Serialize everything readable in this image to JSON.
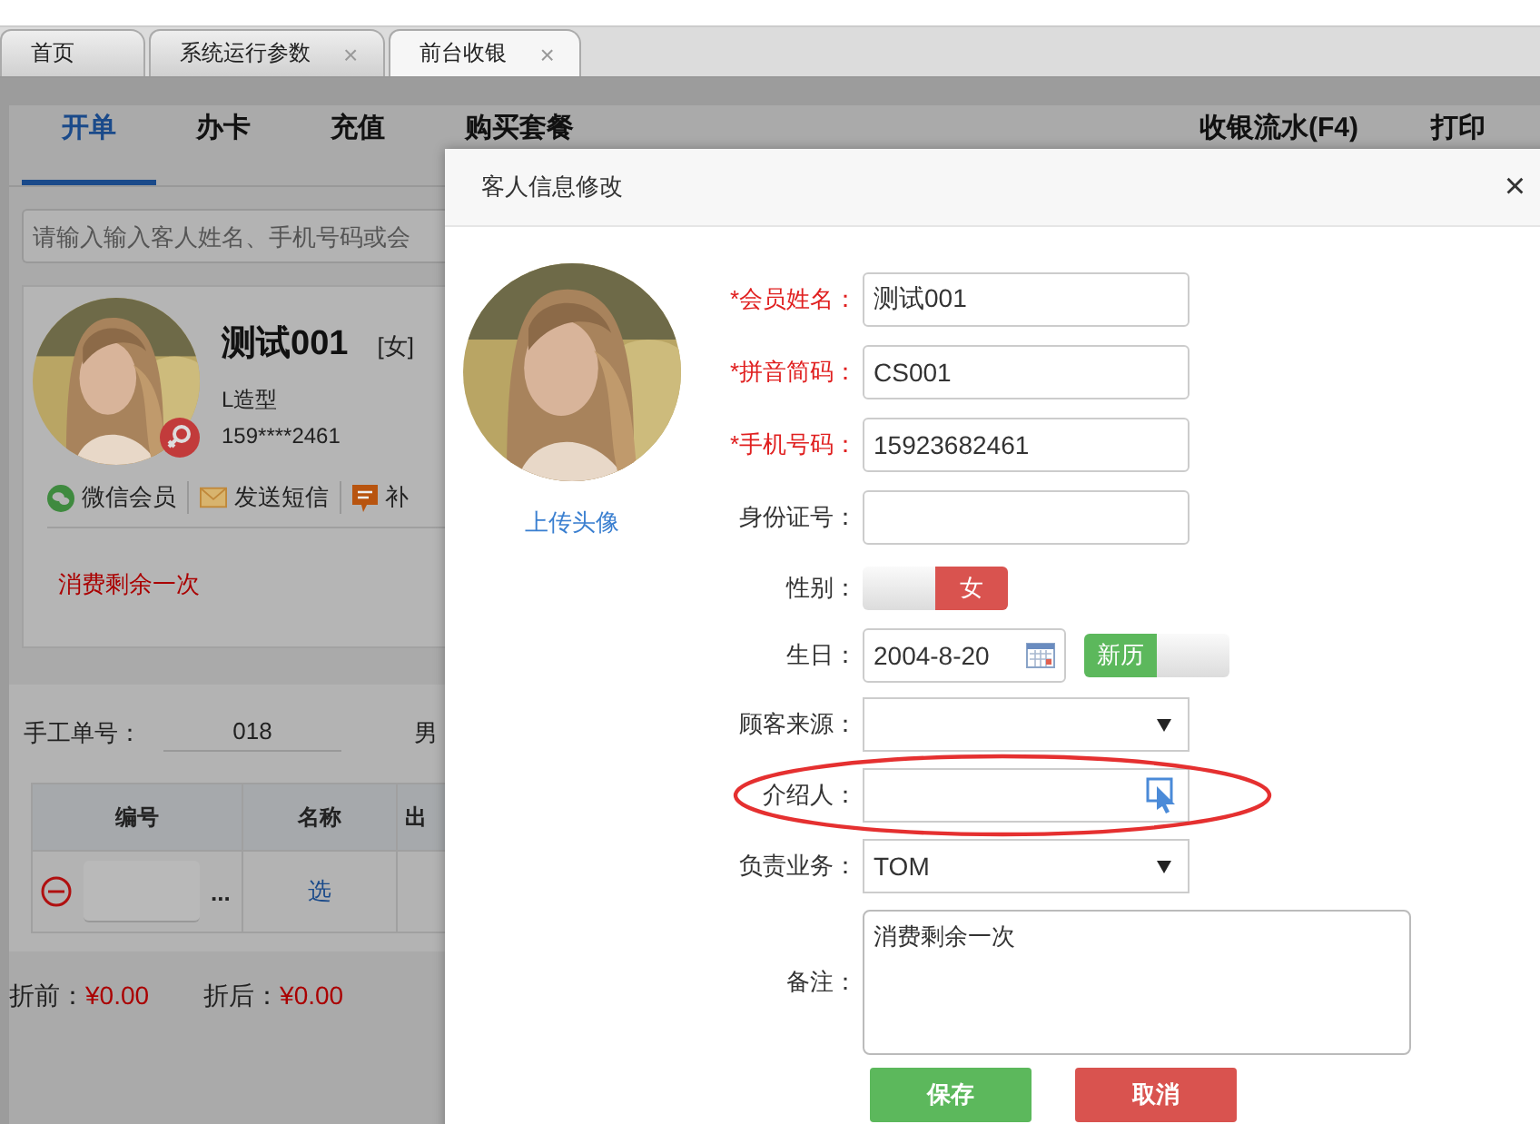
{
  "tabs": [
    {
      "label": "首页",
      "selected": false
    },
    {
      "label": "系统运行参数",
      "close": "×",
      "selected": false
    },
    {
      "label": "前台收银",
      "close": "×",
      "selected": true
    }
  ],
  "nav": {
    "tabs": [
      {
        "label": "开单",
        "selected": true
      },
      {
        "label": "办卡",
        "selected": false
      },
      {
        "label": "充值",
        "selected": false
      },
      {
        "label": "购买套餐",
        "selected": false
      }
    ],
    "actions": [
      "收银流水(F4)",
      "打印"
    ]
  },
  "search": {
    "placeholder": "请输入输入客人姓名、手机号码或会"
  },
  "customer": {
    "female": true,
    "name": "测试001",
    "gender": "[女]",
    "type": "L造型",
    "phone": "159****2461",
    "actions": [
      {
        "kind": "wechat",
        "label": "微信会员"
      },
      {
        "kind": "sms",
        "label": "发送短信"
      },
      {
        "kind": "message",
        "label": "补"
      }
    ],
    "note": "消费剩余一次"
  },
  "order": {
    "manual_no_label": "手工单号：",
    "manual_no": "018",
    "column_3": "男",
    "table": {
      "columns": [
        "编号",
        "名称",
        "出"
      ],
      "rows": [
        {
          "more": "...",
          "name_link": "选"
        }
      ]
    }
  },
  "totals": [
    {
      "label": "折前：",
      "value": "¥0.00"
    },
    {
      "label": "折后：",
      "value": "¥0.00"
    }
  ],
  "dialog": {
    "title": "客人信息修改",
    "close": "×",
    "upload": "上传头像",
    "fields": [
      {
        "kind": "text",
        "label": "*会员姓名：",
        "required": true,
        "value": "测试001"
      },
      {
        "kind": "text",
        "label": "*拼音简码：",
        "required": true,
        "value": "CS001"
      },
      {
        "kind": "text",
        "label": "*手机号码：",
        "required": true,
        "value": "15923682461"
      },
      {
        "kind": "text",
        "label": "身份证号：",
        "required": false
      },
      {
        "kind": "toggle",
        "label": "性别：",
        "required": false,
        "text": "女",
        "on": true
      },
      {
        "kind": "date",
        "label": "生日：",
        "required": false,
        "value": "2004-8-20",
        "calendar": {
          "label": "新历",
          "on": true
        }
      },
      {
        "kind": "select",
        "label": "顾客来源：",
        "required": false
      },
      {
        "kind": "picker",
        "label": "介绍人：",
        "required": false,
        "highlighted": true
      },
      {
        "kind": "select",
        "label": "负责业务：",
        "required": false,
        "value": "TOM"
      },
      {
        "kind": "textarea",
        "label": "备注：",
        "required": false,
        "value": "消费剩余一次"
      }
    ],
    "buttons": [
      {
        "kind": "primary",
        "label": "保存"
      },
      {
        "kind": "danger",
        "label": "取消"
      }
    ]
  }
}
